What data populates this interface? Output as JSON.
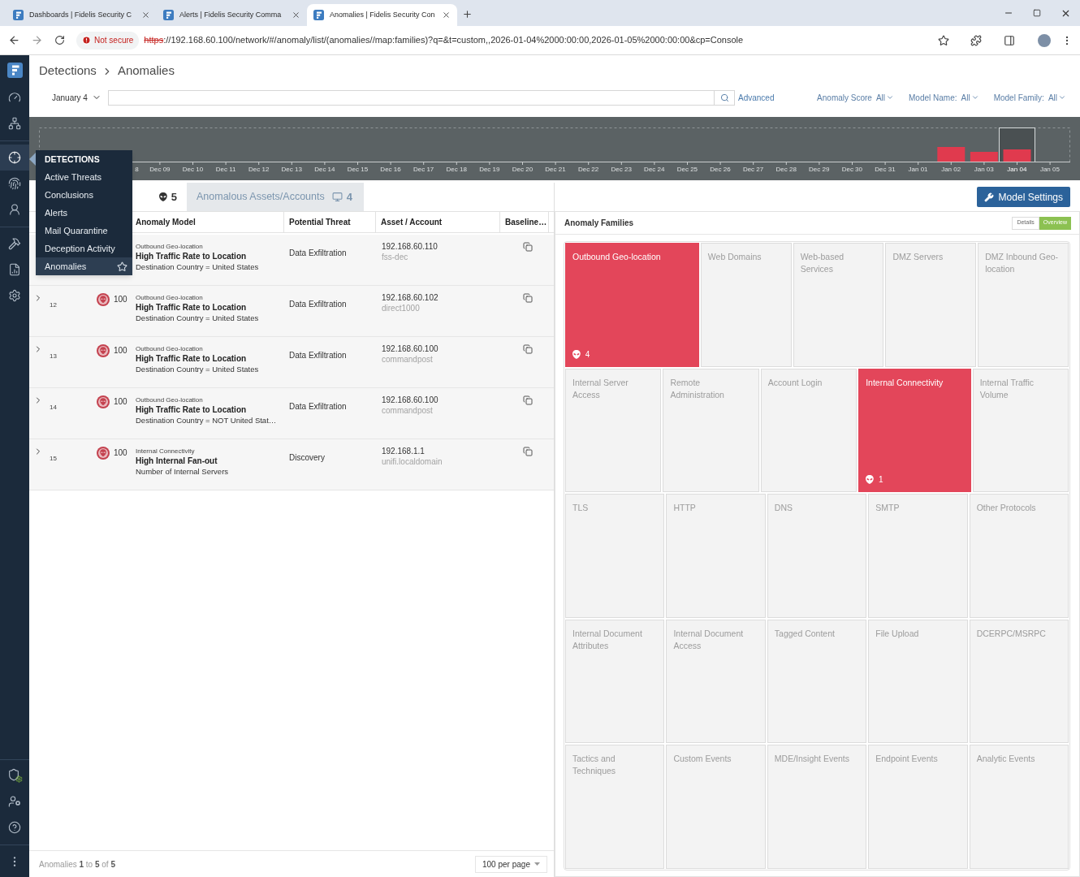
{
  "browser": {
    "tabs": [
      {
        "title": "Dashboards | Fidelis Security C",
        "selected": false
      },
      {
        "title": "Alerts | Fidelis Security Comma",
        "selected": false
      },
      {
        "title": "Anomalies | Fidelis Security Con",
        "selected": true
      }
    ],
    "security": "Not secure",
    "url_scheme": "https",
    "url_rest": "://192.168.60.100/network/#/anomaly/list/(anomalies//map:families)?q=&t=custom,,2026-01-04%2000:00:00,2026-01-05%2000:00:00&cp=Console"
  },
  "sidebar": {
    "top_groups": [
      [
        {
          "selected": false
        },
        {
          "selected": false
        }
      ],
      [
        {
          "selected": true
        },
        {
          "selected": false
        },
        {
          "selected": false
        }
      ],
      [
        {
          "selected": false
        },
        {
          "selected": false
        },
        {
          "selected": false
        }
      ]
    ],
    "bottom_groups": [
      [
        {
          "selected": false
        },
        {
          "selected": false
        },
        {
          "selected": false
        }
      ],
      [
        {
          "selected": false
        }
      ]
    ]
  },
  "flyout_menu": {
    "title": "DETECTIONS",
    "items": [
      {
        "label": "Active Threats",
        "selected": false
      },
      {
        "label": "Conclusions",
        "selected": false
      },
      {
        "label": "Alerts",
        "selected": false
      },
      {
        "label": "Mail Quarantine",
        "selected": false
      },
      {
        "label": "Deception Activity",
        "selected": false
      },
      {
        "label": "Anomalies",
        "selected": true
      }
    ]
  },
  "breadcrumb": [
    "Detections",
    "Anomalies"
  ],
  "filters": {
    "date": "January 4",
    "advanced": "Advanced",
    "dropdowns": [
      {
        "label": "Anomaly Score",
        "value": "All"
      },
      {
        "label": "Model Name:",
        "value": "All"
      },
      {
        "label": "Model Family:",
        "value": "All"
      }
    ]
  },
  "timeline": {
    "dates": [
      {
        "label": "8",
        "selected": false
      },
      {
        "label": "Dec 09",
        "selected": false
      },
      {
        "label": "Dec 10",
        "selected": false
      },
      {
        "label": "Dec 11",
        "selected": false
      },
      {
        "label": "Dec 12",
        "selected": false
      },
      {
        "label": "Dec 13",
        "selected": false
      },
      {
        "label": "Dec 14",
        "selected": false
      },
      {
        "label": "Dec 15",
        "selected": false
      },
      {
        "label": "Dec 16",
        "selected": false
      },
      {
        "label": "Dec 17",
        "selected": false
      },
      {
        "label": "Dec 18",
        "selected": false
      },
      {
        "label": "Dec 19",
        "selected": false
      },
      {
        "label": "Dec 20",
        "selected": false
      },
      {
        "label": "Dec 21",
        "selected": false
      },
      {
        "label": "Dec 22",
        "selected": false
      },
      {
        "label": "Dec 23",
        "selected": false
      },
      {
        "label": "Dec 24",
        "selected": false
      },
      {
        "label": "Dec 25",
        "selected": false
      },
      {
        "label": "Dec 26",
        "selected": false
      },
      {
        "label": "Dec 27",
        "selected": false
      },
      {
        "label": "Dec 28",
        "selected": false
      },
      {
        "label": "Dec 29",
        "selected": false
      },
      {
        "label": "Dec 30",
        "selected": false
      },
      {
        "label": "Dec 31",
        "selected": false
      },
      {
        "label": "Jan 01",
        "selected": false
      },
      {
        "label": "Jan 02",
        "selected": false
      },
      {
        "label": "Jan 03",
        "selected": false
      },
      {
        "label": "Jan 04",
        "selected": true
      },
      {
        "label": "Jan 05",
        "selected": false
      }
    ]
  },
  "table": {
    "tabs": [
      {
        "count": "5",
        "selected": true
      },
      {
        "label": "Anomalous Assets/Accounts",
        "count": "4",
        "selected": false
      }
    ],
    "columns": [
      "Anomaly Model",
      "Potential Threat",
      "Asset / Account",
      "Baseline…"
    ],
    "rows": [
      {
        "family": "Outbound Geo-location",
        "model": "High Traffic Rate to Location",
        "detail": "Destination Country = United States",
        "threat": "Data Exfiltration",
        "ip": "192.168.60.110",
        "host": "fss-dec"
      },
      {
        "id": "12",
        "score": "100",
        "family": "Outbound Geo-location",
        "model": "High Traffic Rate to Location",
        "detail": "Destination Country = United States",
        "threat": "Data Exfiltration",
        "ip": "192.168.60.102",
        "host": "direct1000"
      },
      {
        "id": "13",
        "score": "100",
        "family": "Outbound Geo-location",
        "model": "High Traffic Rate to Location",
        "detail": "Destination Country = United States",
        "threat": "Data Exfiltration",
        "ip": "192.168.60.100",
        "host": "commandpost"
      },
      {
        "id": "14",
        "score": "100",
        "family": "Outbound Geo-location",
        "model": "High Traffic Rate to Location",
        "detail": "Destination Country = NOT United Stat…",
        "threat": "Data Exfiltration",
        "ip": "192.168.60.100",
        "host": "commandpost"
      },
      {
        "id": "15",
        "score": "100",
        "family": "Internal Connectivity",
        "model": "High Internal Fan-out",
        "detail": "Number of Internal Servers",
        "threat": "Discovery",
        "ip": "192.168.1.1",
        "host": "unifi.localdomain"
      }
    ]
  },
  "pagination": {
    "summary": "Anomalies **1** to **5** of **5**",
    "per_page": "100 per page"
  },
  "model_settings": "Model Settings",
  "families": {
    "title": "Anomaly Families",
    "views": [
      {
        "label": "Details",
        "selected": false
      },
      {
        "label": "Overview",
        "selected": true
      }
    ],
    "rows": [
      [
        {
          "label": "Outbound Geo-location",
          "active": true,
          "count": "4"
        },
        {
          "label": "Web Domains",
          "active": false
        },
        {
          "label": "Web-based Services",
          "active": false
        },
        {
          "label": "DMZ Servers",
          "active": false
        },
        {
          "label": "DMZ Inbound Geo-location",
          "active": false
        }
      ],
      [
        {
          "label": "Internal Server Access",
          "active": false
        },
        {
          "label": "Remote Administration",
          "active": false
        },
        {
          "label": "Account Login",
          "active": false
        },
        {
          "label": "Internal Connectivity",
          "active": true,
          "count": "1"
        },
        {
          "label": "Internal Traffic Volume",
          "active": false
        }
      ],
      [
        {
          "label": "TLS",
          "active": false
        },
        {
          "label": "HTTP",
          "active": false
        },
        {
          "label": "DNS",
          "active": false
        },
        {
          "label": "SMTP",
          "active": false
        },
        {
          "label": "Other Protocols",
          "active": false
        }
      ],
      [
        {
          "label": "Internal Document Attributes",
          "active": false
        },
        {
          "label": "Internal Document Access",
          "active": false
        },
        {
          "label": "Tagged Content",
          "active": false
        },
        {
          "label": "File Upload",
          "active": false
        },
        {
          "label": "DCERPC/MSRPC",
          "active": false
        }
      ],
      [
        {
          "label": "Tactics and Techniques",
          "active": false
        },
        {
          "label": "Custom Events",
          "active": false
        },
        {
          "label": "MDE/Insight Events",
          "active": false
        },
        {
          "label": "Endpoint Events",
          "active": false
        },
        {
          "label": "Analytic Events",
          "active": false
        }
      ]
    ]
  }
}
